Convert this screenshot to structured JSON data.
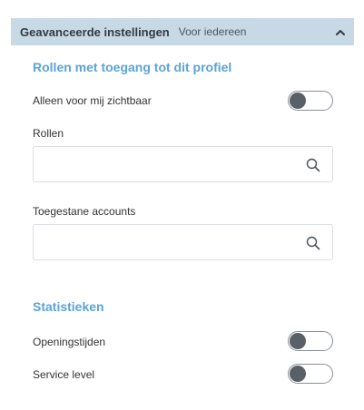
{
  "header": {
    "title": "Geavanceerde instellingen",
    "subtitle": "Voor iedereen",
    "icon": "chevron-up-icon"
  },
  "roles_section": {
    "title": "Rollen met toegang tot dit profiel",
    "visible_only_me": {
      "label": "Alleen voor mij zichtbaar",
      "enabled": false
    },
    "roles": {
      "label": "Rollen",
      "value": "",
      "icon": "search-icon"
    },
    "allowed_accounts": {
      "label": "Toegestane accounts",
      "value": "",
      "icon": "search-icon"
    }
  },
  "statistics_section": {
    "title": "Statistieken",
    "opening_hours": {
      "label": "Openingstijden",
      "enabled": false
    },
    "service_level": {
      "label": "Service level",
      "enabled": false
    }
  },
  "colors": {
    "header_bg": "#c8d9e6",
    "section_title": "#5ba3d6",
    "toggle_knob": "#5a6068"
  }
}
